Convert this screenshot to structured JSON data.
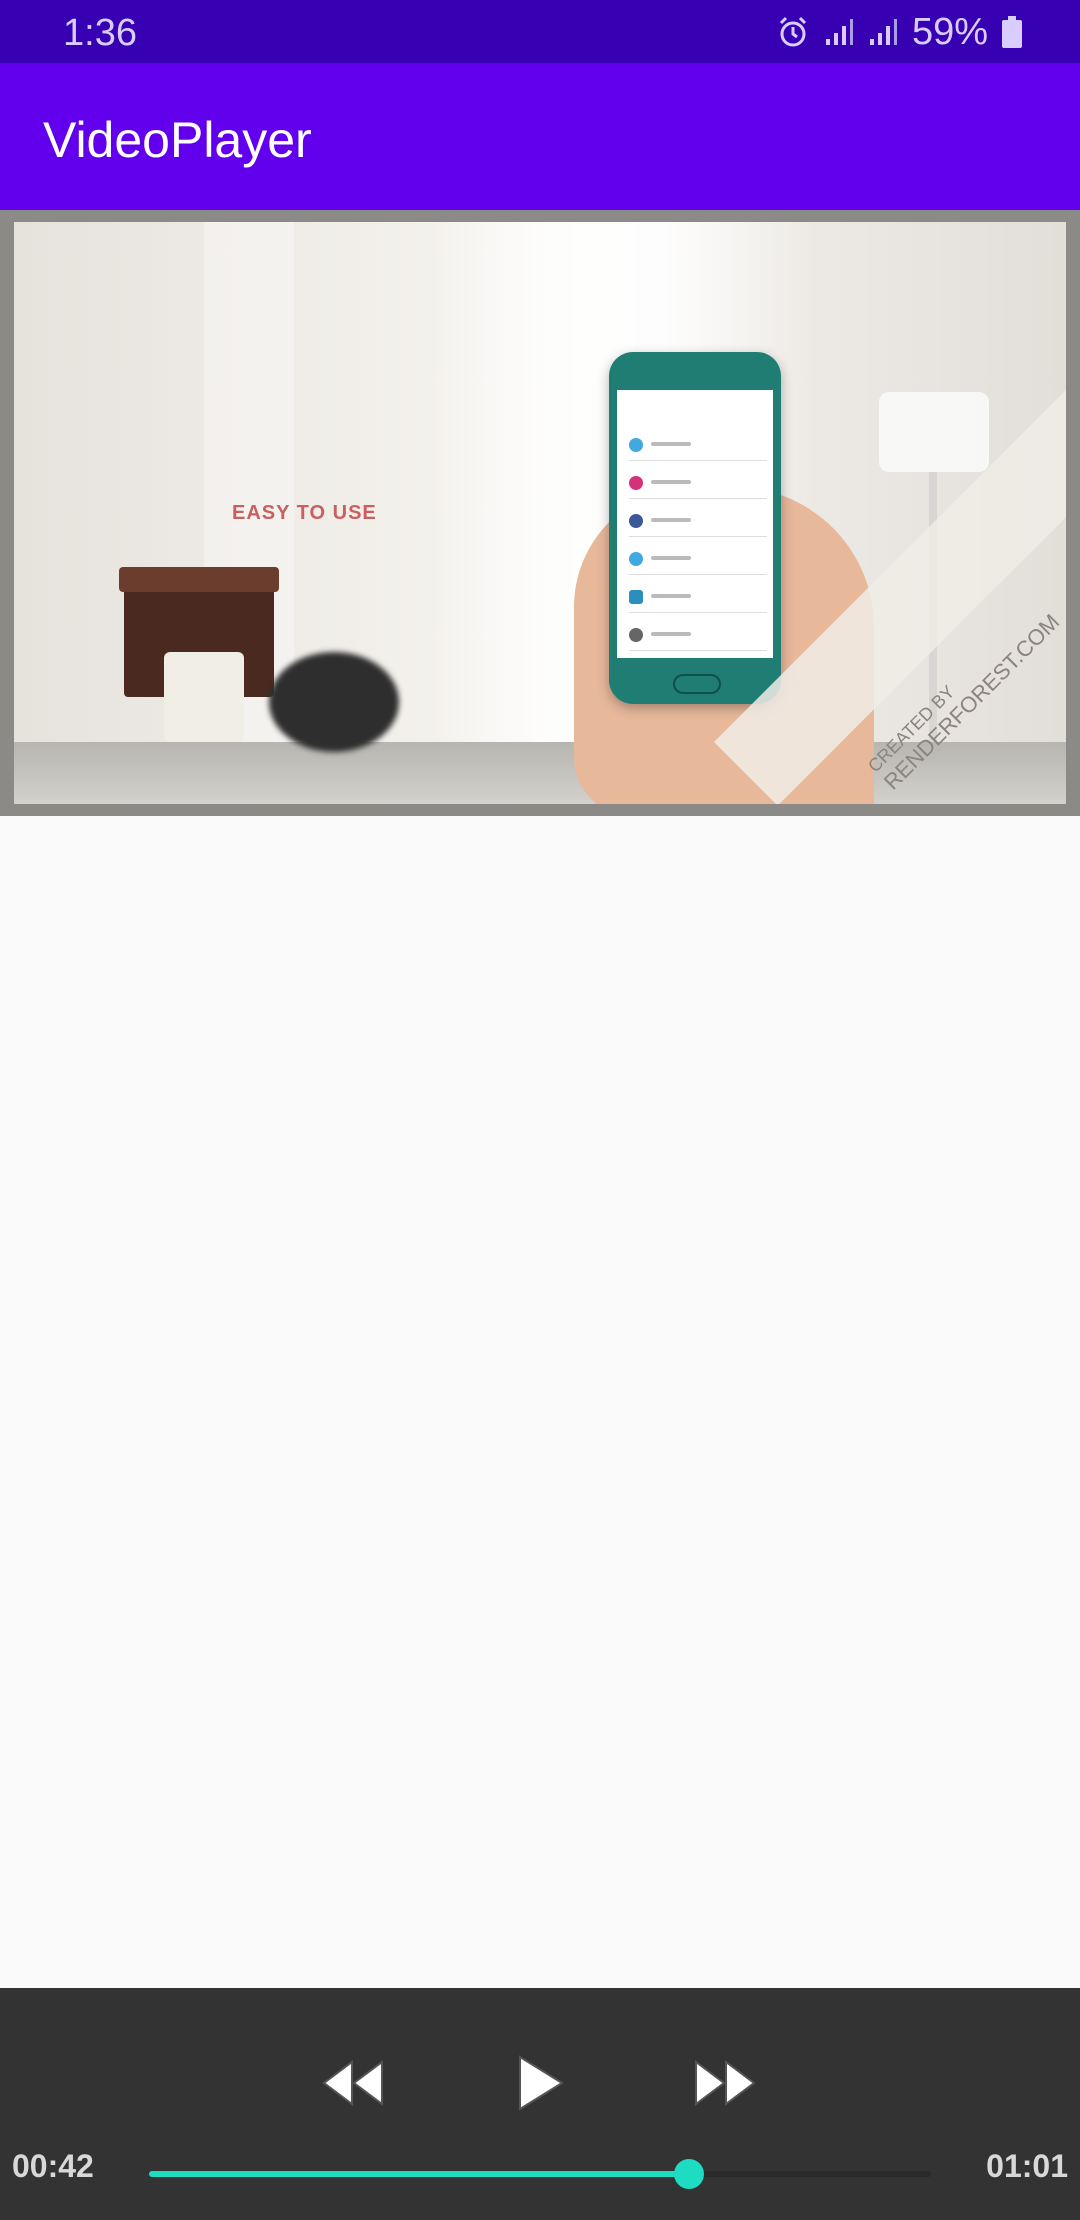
{
  "status_bar": {
    "time": "1:36",
    "battery": "59%",
    "icons": [
      "alarm-icon",
      "signal-icon",
      "signal-icon",
      "battery-icon"
    ]
  },
  "app_bar": {
    "title": "VideoPlayer"
  },
  "video": {
    "overlay_text": "EASY TO USE",
    "watermark_line1": "CREATED BY",
    "watermark_line2": "RENDERFOREST.COM"
  },
  "player": {
    "current_time": "00:42",
    "total_time": "01:01",
    "progress": 0.69,
    "buttons": [
      "rewind-icon",
      "play-icon",
      "fast-forward-icon"
    ],
    "accent": "#1ddcc2"
  }
}
